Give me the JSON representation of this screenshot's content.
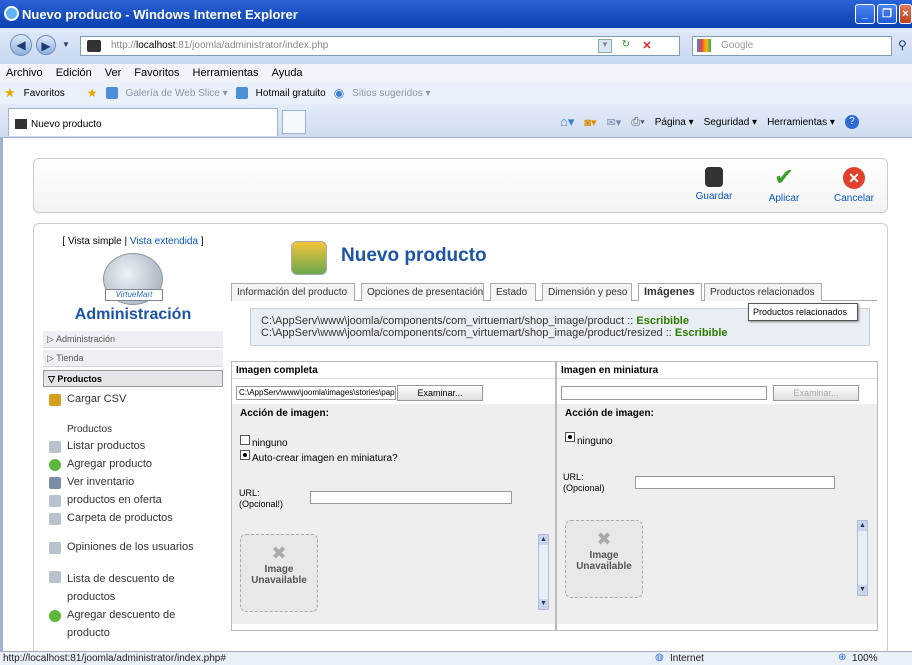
{
  "window": {
    "title": "Nuevo producto - Windows Internet Explorer"
  },
  "address": {
    "url_prefix": "http://",
    "url_host": "localhost",
    "url_rest": ":81/joomla/administrator/index.php",
    "search_placeholder": "Google"
  },
  "menu": [
    "Archivo",
    "Edición",
    "Ver",
    "Favoritos",
    "Herramientas",
    "Ayuda"
  ],
  "favbar": {
    "favoritos": "Favoritos",
    "galeria": "Galería de Web Slice ▾",
    "hotmail": "Hotmail gratuito",
    "sitios": "Sitios sugeridos ▾"
  },
  "tab": {
    "label": "Nuevo producto"
  },
  "commandbar": {
    "pagina": "Página ▾",
    "seguridad": "Seguridad ▾",
    "herramientas": "Herramientas ▾"
  },
  "toolbar": {
    "guardar": "Guardar",
    "aplicar": "Aplicar",
    "cancelar": "Cancelar"
  },
  "sidebar": {
    "vista_simple": "[ Vista simple |",
    "vista_extendida": "Vista extendida",
    "vista_close": "]",
    "logo_label": "VirtueMart",
    "title": "Administración",
    "sections": [
      "Administración",
      "Tienda",
      "Productos"
    ],
    "cargar_csv": "Cargar CSV",
    "productos_heading": "Productos",
    "items": [
      "Listar productos",
      "Agregar producto",
      "Ver inventario",
      "productos en oferta",
      "Carpeta de productos"
    ],
    "opiniones": "Opiniones de los usuarios",
    "descuento1": "Lista de descuento de",
    "descuento2": "productos",
    "agregar_desc1": "Agregar descuento de",
    "agregar_desc2": "producto"
  },
  "main": {
    "title": "Nuevo producto",
    "tabs": [
      "Información del producto",
      "Opciones de presentación",
      "Estado",
      "Dimensión y peso",
      "Imágenes",
      "Productos relacionados"
    ],
    "tooltip": "Productos relacionados",
    "path1": "C:\\AppServ\\www\\joomla/components/com_virtuemart/shop_image/product",
    "path2": "C:\\AppServ\\www\\joomla/components/com_virtuemart/shop_image/product/resized",
    "path_sep": " :: ",
    "escribible": "Escribible"
  },
  "imagen_completa": {
    "heading": "Imagen completa",
    "file_value": "C:\\AppServ\\www\\joomla\\images\\stories\\papeleri",
    "examinar": "Examinar...",
    "accion": "Acción de imagen:",
    "opt_ninguno": "ninguno",
    "opt_auto": "Auto-crear imagen en miniatura?",
    "url_label1": "URL:",
    "url_label2": "(Opcional!)",
    "img_line1": "Image",
    "img_line2": "Unavailable"
  },
  "imagen_miniatura": {
    "heading": "Imagen en miniatura",
    "examinar": "Examinar...",
    "accion": "Acción de imagen:",
    "opt_ninguno": "ninguno",
    "url_label1": "URL:",
    "url_label2": "(Opcional)",
    "img_line1": "Image",
    "img_line2": "Unavailable"
  },
  "status": {
    "url": "http://localhost:81/joomla/administrator/index.php#",
    "zone": "Internet",
    "zoom": "100%"
  }
}
